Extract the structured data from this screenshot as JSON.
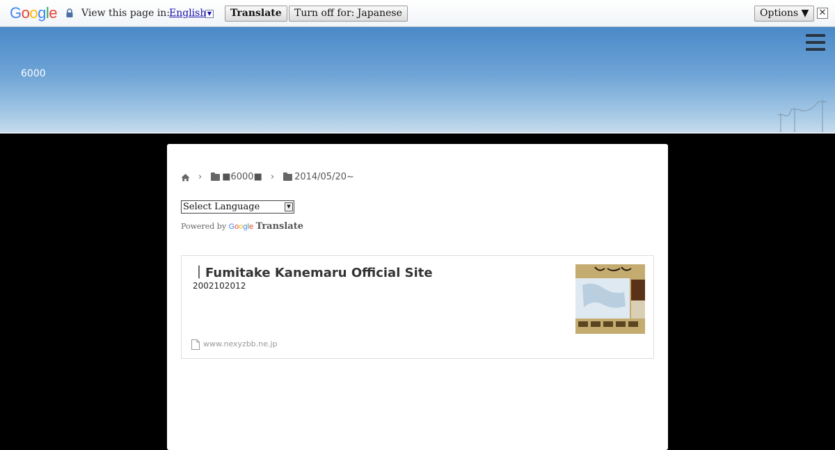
{
  "translate_bar": {
    "logo": "Google",
    "view_label": "View this page in:",
    "language": "English",
    "translate_button": "Translate",
    "turn_off_button": "Turn off for: Japanese",
    "options_button": "Options ▼",
    "close": "✕"
  },
  "header": {
    "site_title": "6000"
  },
  "breadcrumb": {
    "items": [
      "■6000■",
      "2014/05/20~"
    ]
  },
  "language_select": {
    "selected": "Select Language"
  },
  "powered_by": {
    "prefix": "Powered by",
    "google": "Google",
    "translate": "Translate"
  },
  "link_card": {
    "title": "｜Fumitake Kanemaru Official Site",
    "description": "2002102012",
    "url": "www.nexyzbb.ne.jp"
  },
  "colors": {
    "page_background": "#000000",
    "link_blue": "#1a0dab"
  }
}
